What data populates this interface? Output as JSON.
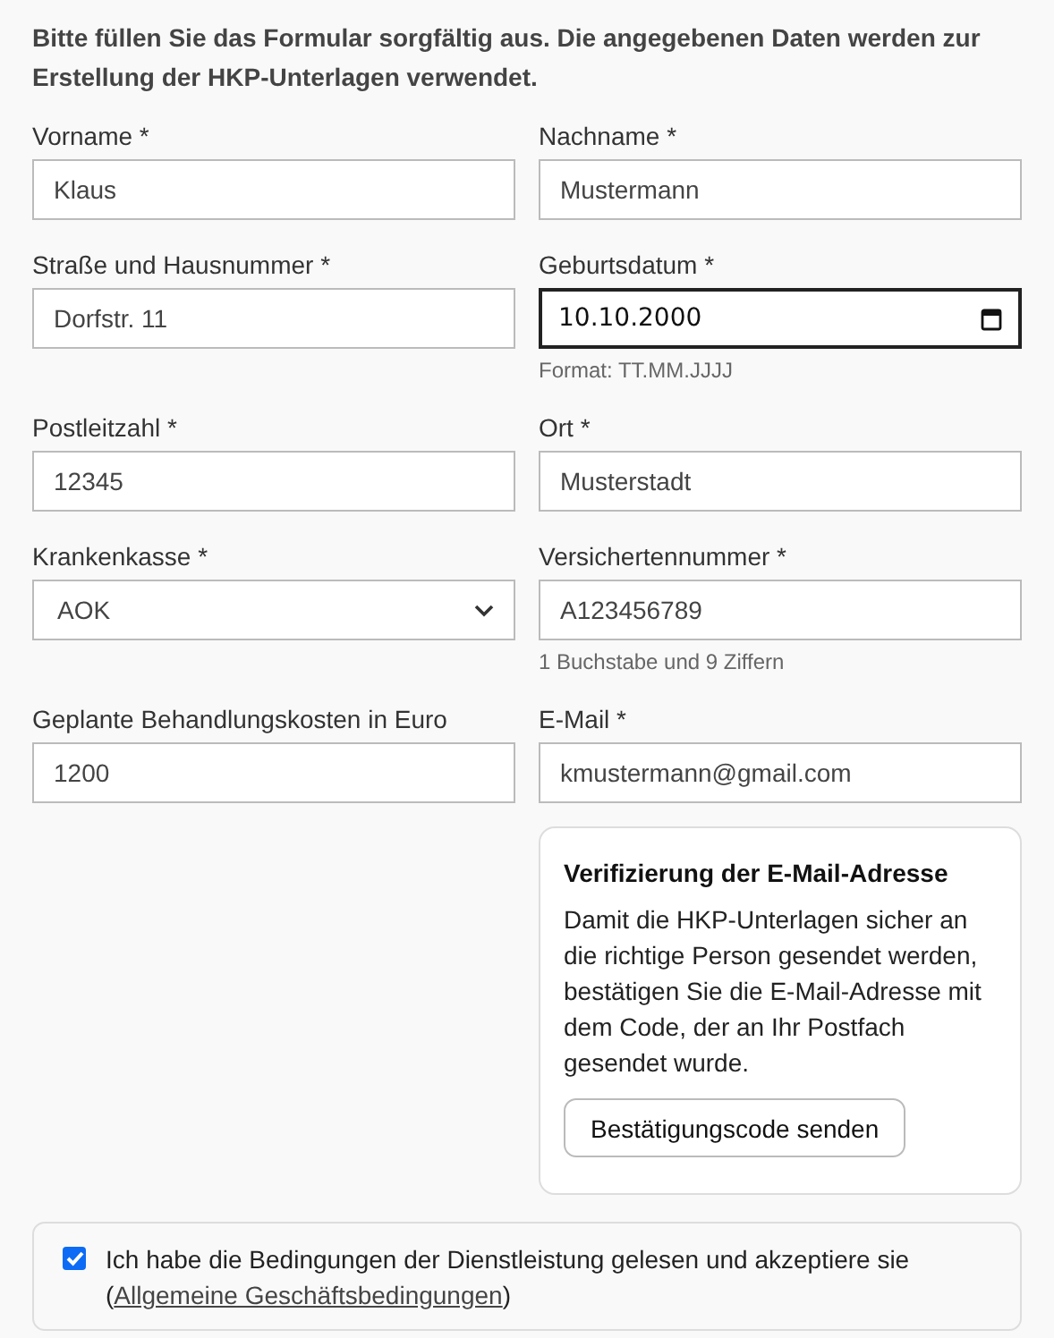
{
  "intro": "Bitte füllen Sie das Formular sorgfältig aus. Die angegebenen Daten werden zur Erstellung der HKP-Unterlagen verwendet.",
  "fields": [
    {
      "label": "Vorname *",
      "kind": "text",
      "value": "Klaus",
      "focused": false
    },
    {
      "label": "Nachname *",
      "kind": "text",
      "value": "Mustermann",
      "focused": false
    },
    {
      "label": "Straße und Hausnummer *",
      "kind": "text",
      "value": "Dorfstr. 11",
      "focused": false
    },
    {
      "label": "Geburtsdatum *",
      "kind": "date",
      "value": "10.10.2000",
      "focused": true,
      "hint": "Format: TT.MM.JJJJ"
    },
    {
      "label": "Postleitzahl *",
      "kind": "text",
      "value": "12345",
      "focused": false
    },
    {
      "label": "Ort *",
      "kind": "text",
      "value": "Musterstadt",
      "focused": false
    },
    {
      "label": "Krankenkasse *",
      "kind": "select",
      "value": "AOK",
      "focused": false
    },
    {
      "label": "Versichertennummer *",
      "kind": "text",
      "value": "A123456789",
      "focused": false,
      "hint": "1 Buchstabe und 9 Ziffern"
    },
    {
      "label": "Geplante Behandlungskosten in Euro",
      "kind": "text",
      "value": "1200",
      "focused": false
    },
    {
      "label": "E-Mail *",
      "kind": "text",
      "value": "kmustermann@gmail.com",
      "focused": false
    }
  ],
  "verification": {
    "title": "Verifizierung der E-Mail-Adresse",
    "text": "Damit die HKP-Unterlagen sicher an die richtige Person gesendet werden, bestätigen Sie die E-Mail-Adresse mit dem Code, der an Ihr Postfach gesendet wurde.",
    "button": "Bestätigungscode senden"
  },
  "terms": {
    "checked": true,
    "text": "Ich habe die Bedingungen der Dienstleistung gelesen und akzeptiere sie (",
    "link": "Allgemeine Geschäftsbedingungen",
    "text_after": ")"
  }
}
